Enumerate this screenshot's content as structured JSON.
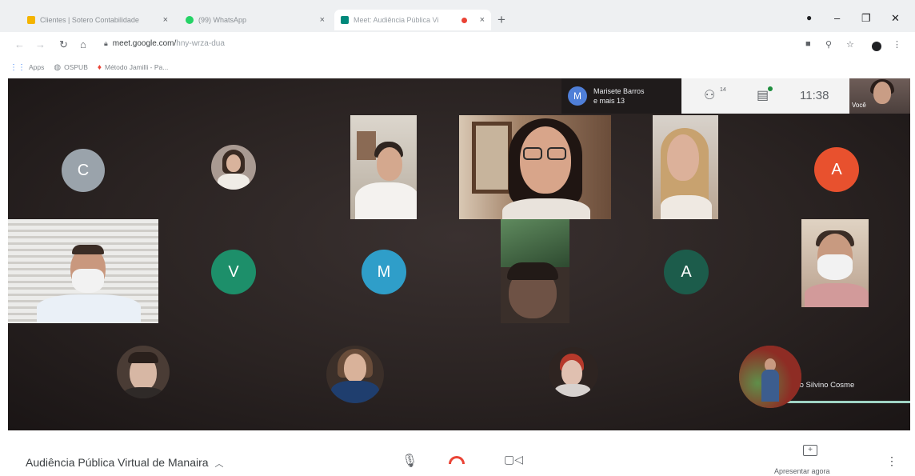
{
  "browser": {
    "tabs": [
      {
        "label": "Clientes | Sotero Contabilidade",
        "favicon_color": "#f4b400"
      },
      {
        "label": "(99) WhatsApp",
        "favicon_color": "#25d366"
      },
      {
        "label": "Meet: Audiência Pública Vi",
        "favicon_color": "#00897b",
        "active": true,
        "recording": true
      }
    ],
    "url_host": "meet.google.com/",
    "url_path": "hny-wrza-dua",
    "bookmarks": [
      {
        "label": "Apps",
        "icon": "apps-grid-icon"
      },
      {
        "label": "OSPUB",
        "icon": "globe-icon"
      },
      {
        "label": "Método Jamilli - Pa...",
        "icon": "flame-icon"
      }
    ]
  },
  "meet": {
    "presenter": {
      "initial": "M",
      "name": "Marisete Barros",
      "others": "e mais 13"
    },
    "people_badge": "14",
    "time": "11:38",
    "self_label": "Você",
    "participants": [
      {
        "initial": "C",
        "color": "#9aa3ab"
      },
      {
        "initial": "A",
        "color": "#e8512e"
      },
      {
        "initial": "V",
        "color": "#1d8f6a"
      },
      {
        "initial": "M",
        "color": "#2f9ec9"
      },
      {
        "initial": "A",
        "color": "#1c5c4b"
      }
    ],
    "speaking_name": "Evandro Silvino Cosme",
    "speaking_dots": "···",
    "meeting_title": "Audiência Pública Virtual de Manaira",
    "present_label": "Apresentar agora"
  }
}
